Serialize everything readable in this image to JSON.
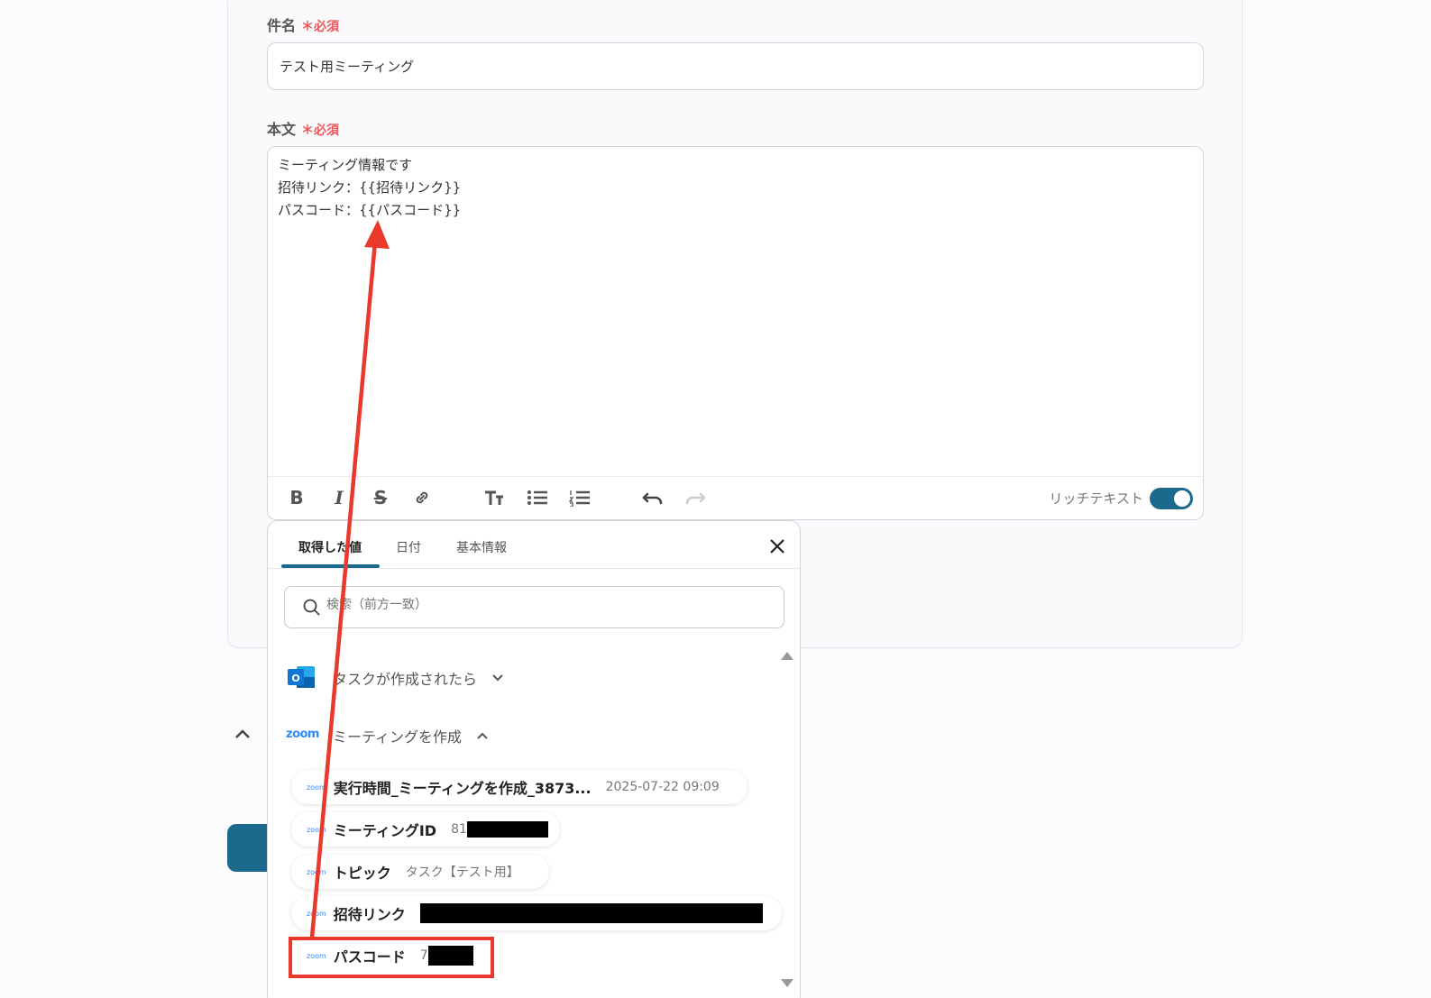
{
  "subject": {
    "label": "件名",
    "required": "＊必須",
    "value": "テスト用ミーティング"
  },
  "body": {
    "label": "本文",
    "required": "＊必須",
    "lines": [
      "ミーティング情報です",
      "招待リンク：{{招待リンク}}",
      "パスコード：{{パスコード}}"
    ],
    "rich_text_label": "リッチテキスト"
  },
  "panel": {
    "tabs": [
      {
        "label": "取得した値"
      },
      {
        "label": "日付"
      },
      {
        "label": "基本情報"
      }
    ],
    "search_placeholder": "検索（前方一致）",
    "groups": [
      {
        "title": "タスクが作成されたら",
        "icon": "outlook-icon"
      },
      {
        "title": "ミーティングを作成",
        "icon": "zoom-logo",
        "logo_text": "zoom"
      }
    ],
    "items": [
      {
        "name": "実行時間_ミーティングを作成_3873...",
        "value": "2025-07-22 09:09",
        "logo": "zoom"
      },
      {
        "name": "ミーティングID",
        "value": "81",
        "logo": "zoom"
      },
      {
        "name": "トピック",
        "value": "タスク【テスト用】",
        "logo": "zoom"
      },
      {
        "name": "招待リンク",
        "value": "",
        "logo": "zoom"
      },
      {
        "name": "パスコード",
        "value": "7",
        "logo": "zoom"
      }
    ]
  },
  "colors": {
    "accent": "#1b6a8d",
    "required": "#e85a5a",
    "annotation": "#e8392c",
    "zoom": "#2d8cff"
  }
}
